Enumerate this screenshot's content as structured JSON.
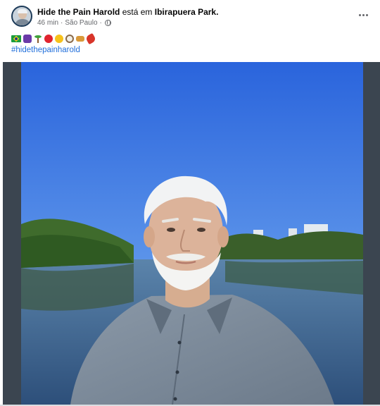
{
  "post": {
    "author": "Hide the Pain Harold",
    "verb": "está em",
    "place": "Ibirapuera Park.",
    "time": "46 min",
    "separator": "·",
    "location": "São Paulo",
    "separator2": "·",
    "privacy_icon": "globe-icon",
    "more_icon": "more-options-icon",
    "emojis": [
      "brazil-flag",
      "grape",
      "palm-tree",
      "hibiscus",
      "sun",
      "coconut",
      "pastel",
      "pepper"
    ],
    "hashtag": "#hidethepainharold",
    "photo_subject": "man-in-park-selfie"
  },
  "colors": {
    "link": "#216fdb",
    "secondary_text": "#65676b",
    "photo_frame": "#3b4550",
    "sky": "#2f6fe0",
    "water": "#3a5f8a"
  }
}
